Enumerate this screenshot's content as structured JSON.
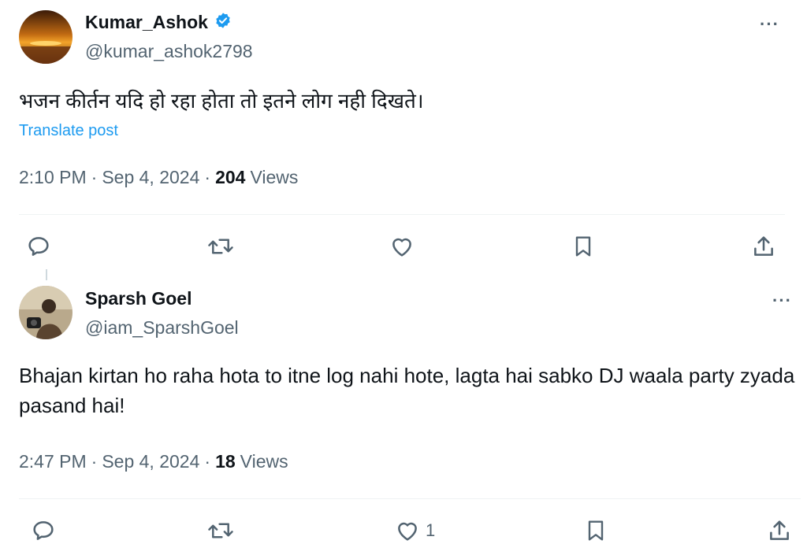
{
  "posts": [
    {
      "display_name": "Kumar_Ashok",
      "verified": true,
      "handle": "@kumar_ashok2798",
      "text": "भजन कीर्तन यदि हो रहा होता तो इतने लोग नही दिखते।",
      "translate_label": "Translate post",
      "time": "2:10 PM",
      "date": "Sep 4, 2024",
      "views_count": "204",
      "views_label": "Views",
      "separator": "·",
      "more_label": "···",
      "like_count": ""
    },
    {
      "display_name": "Sparsh Goel",
      "verified": false,
      "handle": "@iam_SparshGoel",
      "text": "Bhajan kirtan ho raha hota to itne log nahi hote, lagta hai sabko DJ waala party zyada pasand hai!",
      "time": "2:47 PM",
      "date": "Sep 4, 2024",
      "views_count": "18",
      "views_label": "Views",
      "separator": "·",
      "more_label": "···",
      "like_count": "1"
    }
  ],
  "colors": {
    "text": "#0f1419",
    "secondary": "#536471",
    "accent": "#1d9bf0",
    "divider": "#eff3f4"
  },
  "icons": [
    "verified-badge-icon",
    "more-icon",
    "reply-icon",
    "repost-icon",
    "like-icon",
    "bookmark-icon",
    "share-icon"
  ]
}
